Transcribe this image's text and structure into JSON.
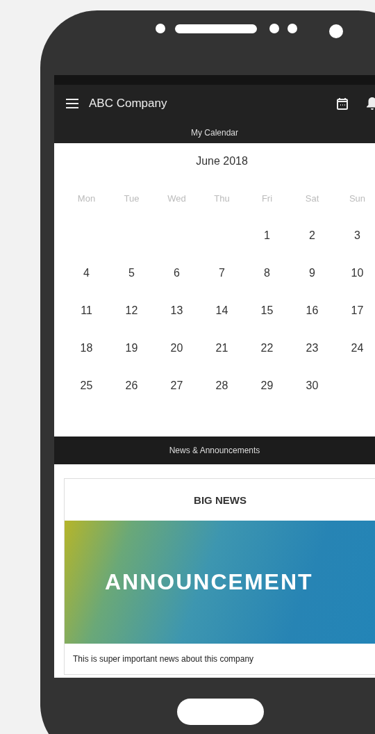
{
  "app_bar": {
    "title": "ABC Company"
  },
  "calendar_section": {
    "title": "My Calendar"
  },
  "calendar": {
    "month": "June 2018",
    "weekdays": [
      "Mon",
      "Tue",
      "Wed",
      "Thu",
      "Fri",
      "Sat",
      "Sun"
    ],
    "weeks": [
      [
        "1",
        "2",
        "3"
      ],
      [
        "4",
        "5",
        "6",
        "7",
        "8",
        "9",
        "10"
      ],
      [
        "11",
        "12",
        "13",
        "14",
        "15",
        "16",
        "17"
      ],
      [
        "18",
        "19",
        "20",
        "21",
        "22",
        "23",
        "24"
      ],
      [
        "25",
        "26",
        "27",
        "28",
        "29",
        "30"
      ]
    ]
  },
  "news_section": {
    "title": "News & Announcements"
  },
  "news_card": {
    "title": "BIG NEWS",
    "banner_text": "ANNOUNCEMENT",
    "body": "This is super important news about this company"
  }
}
